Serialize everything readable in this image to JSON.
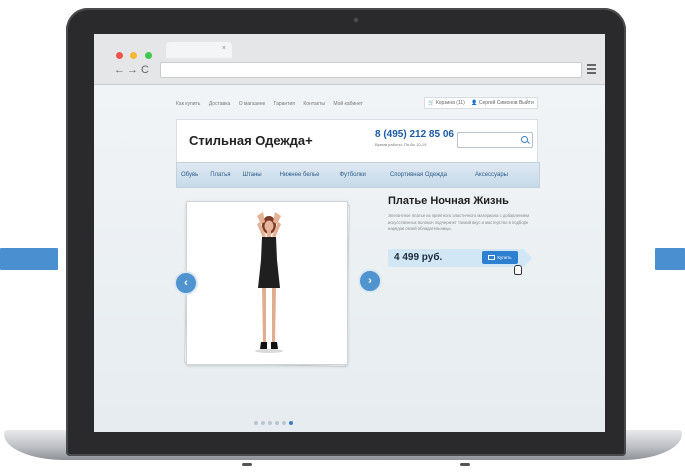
{
  "browser": {
    "traffic_lights": [
      "#f2544a",
      "#f7b731",
      "#3ec84e"
    ],
    "tab_close": "×",
    "nav_back": "←",
    "nav_forward": "→",
    "nav_reload": "C"
  },
  "site": {
    "top_links": [
      "Как купить",
      "Доставка",
      "О магазине",
      "Гарантия",
      "Контакты",
      "Мой кабинет"
    ],
    "cart_label": "Корзина (11)",
    "user_label": "Сергей Симонов Выйти",
    "logo": "Стильная Одежда+",
    "phone": "8 (495) 212 85 06",
    "hours": "Время работы: Пн-Вс 10-19",
    "categories": [
      "Обувь",
      "Платья",
      "Штаны",
      "Нижнее белье",
      "Футболки",
      "Спортивная Одежда",
      "Аксессуары"
    ],
    "product": {
      "title": "Платье Ночная Жизнь",
      "description": "Элегантное платье из приятного эластичного материала с добавлением искусственных волокон подчеркнет тонкий вкус и мастерство в подборе нарядов своей обладательницы.",
      "price": "4 499 руб.",
      "buy_label": "Купить"
    },
    "slider": {
      "prev": "‹",
      "next": "›",
      "active_dot": 6
    }
  },
  "colors": {
    "accent": "#2d7fd0",
    "arrow": "#4a8fd0"
  }
}
